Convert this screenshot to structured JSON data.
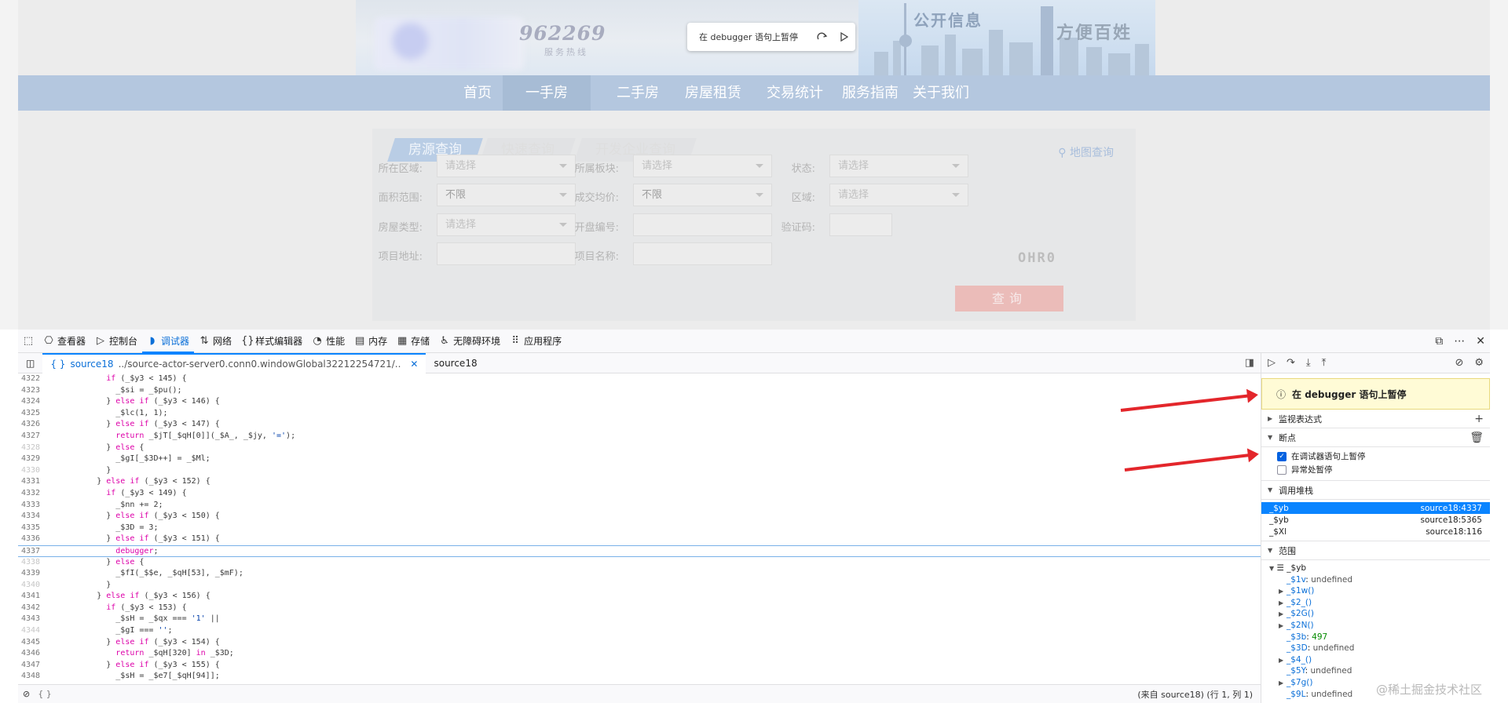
{
  "website": {
    "hotline": "962269",
    "hotline_sub": "服务热线",
    "slogan_left": "公开信息",
    "slogan_right": "方便百姓",
    "nav": [
      "首页",
      "一手房",
      "二手房",
      "房屋租赁",
      "交易统计",
      "服务指南",
      "关于我们"
    ],
    "nav_active": 1,
    "tabs": [
      "房源查询",
      "快速查询",
      "开发企业查询"
    ],
    "map_query": "地图查询",
    "fields": [
      {
        "label": "所在区域:",
        "value": "请选择",
        "type": "select"
      },
      {
        "label": "所属板块:",
        "value": "请选择",
        "type": "select"
      },
      {
        "label": "状态:",
        "value": "请选择",
        "type": "select"
      },
      {
        "label": "面积范围:",
        "value": "不限",
        "type": "select"
      },
      {
        "label": "成交均价:",
        "value": "不限",
        "type": "select"
      },
      {
        "label": "区域:",
        "value": "请选择",
        "type": "select"
      },
      {
        "label": "房屋类型:",
        "value": "请选择",
        "type": "select"
      },
      {
        "label": "开盘编号:",
        "value": "",
        "type": "text"
      },
      {
        "label": "验证码:",
        "value": "",
        "type": "text"
      },
      {
        "label": "项目地址:",
        "value": "",
        "type": "text"
      },
      {
        "label": "项目名称:",
        "value": "",
        "type": "text"
      }
    ],
    "captcha": "OHR0",
    "query_button": "查询"
  },
  "pause_overlay": {
    "label": "在 debugger 语句上暂停"
  },
  "devtools": {
    "tools": [
      {
        "icon": "⎔",
        "label": "查看器"
      },
      {
        "icon": "▷",
        "label": "控制台"
      },
      {
        "icon": "◗",
        "label": "调试器"
      },
      {
        "icon": "⇅",
        "label": "网络"
      },
      {
        "icon": "{}",
        "label": "样式编辑器"
      },
      {
        "icon": "◔",
        "label": "性能"
      },
      {
        "icon": "▤",
        "label": "内存"
      },
      {
        "icon": "▦",
        "label": "存储"
      },
      {
        "icon": "♿",
        "label": "无障碍环境"
      },
      {
        "icon": "⠿",
        "label": "应用程序"
      }
    ],
    "active_tool": 2,
    "source_tabs": [
      {
        "label": "source18",
        "path": "../source-actor-server0.conn0.windowGlobal32212254721/..",
        "active": true
      },
      {
        "label": "source18",
        "path": "",
        "active": false
      }
    ],
    "code_lines": [
      {
        "n": "4322",
        "t": "            if (_$y3 < 145) {",
        "f": false
      },
      {
        "n": "4323",
        "t": "              _$si = _$pu();",
        "f": false
      },
      {
        "n": "4324",
        "t": "            } else if (_$y3 < 146) {",
        "f": false
      },
      {
        "n": "4325",
        "t": "              _$lc(1, 1);",
        "f": false
      },
      {
        "n": "4326",
        "t": "            } else if (_$y3 < 147) {",
        "f": false
      },
      {
        "n": "4327",
        "t": "              return _$jT[_$qH[0]](_$A_, _$jy, '=');",
        "f": false
      },
      {
        "n": "4328",
        "t": "            } else {",
        "f": true
      },
      {
        "n": "4329",
        "t": "              _$gI[_$3D++] = _$Ml;",
        "f": false
      },
      {
        "n": "4330",
        "t": "            }",
        "f": true
      },
      {
        "n": "4331",
        "t": "          } else if (_$y3 < 152) {",
        "f": false
      },
      {
        "n": "4332",
        "t": "            if (_$y3 < 149) {",
        "f": false
      },
      {
        "n": "4333",
        "t": "              _$nn += 2;",
        "f": false
      },
      {
        "n": "4334",
        "t": "            } else if (_$y3 < 150) {",
        "f": false
      },
      {
        "n": "4335",
        "t": "              _$3D = 3;",
        "f": false
      },
      {
        "n": "4336",
        "t": "            } else if (_$y3 < 151) {",
        "f": false
      },
      {
        "n": "4337",
        "t": "              debugger;",
        "f": false
      },
      {
        "n": "4338",
        "t": "            } else {",
        "f": true
      },
      {
        "n": "4339",
        "t": "              _$fI(_$$e, _$qH[53], _$mF);",
        "f": false
      },
      {
        "n": "4340",
        "t": "            }",
        "f": true
      },
      {
        "n": "4341",
        "t": "          } else if (_$y3 < 156) {",
        "f": false
      },
      {
        "n": "4342",
        "t": "            if (_$y3 < 153) {",
        "f": false
      },
      {
        "n": "4343",
        "t": "              _$sH = _$qx === '1' ||",
        "f": false
      },
      {
        "n": "4344",
        "t": "              _$gI === '';",
        "f": true
      },
      {
        "n": "4345",
        "t": "            } else if (_$y3 < 154) {",
        "f": false
      },
      {
        "n": "4346",
        "t": "              return _$qH[320] in _$3D;",
        "f": false
      },
      {
        "n": "4347",
        "t": "            } else if (_$y3 < 155) {",
        "f": false
      },
      {
        "n": "4348",
        "t": "              _$sH = _$e7[_$qH[94]];",
        "f": false
      }
    ],
    "paused_line": "4337",
    "status_left": "{ }",
    "status_pos": "(来自 source18)  (行 1, 列 1)",
    "paused_message": "在 debugger 语句上暂停",
    "watch_label": "监视表达式",
    "breakpoints_label": "断点",
    "bp_options": [
      {
        "label": "在调试器语句上暂停",
        "checked": true
      },
      {
        "label": "异常处暂停",
        "checked": false
      }
    ],
    "callstack_label": "调用堆栈",
    "frames": [
      {
        "name": "_$yb",
        "loc": "source18:4337"
      },
      {
        "name": "_$yb",
        "loc": "source18:5365"
      },
      {
        "name": "_$Xl",
        "loc": "source18:116"
      }
    ],
    "scopes_label": "范围",
    "scope_root": "_$yb",
    "scope_items": [
      {
        "expand": false,
        "name": "_$1v",
        "val": "undefined",
        "kind": "undef"
      },
      {
        "expand": true,
        "name": "_$1w()",
        "val": "",
        "kind": ""
      },
      {
        "expand": true,
        "name": "_$2_()",
        "val": "",
        "kind": ""
      },
      {
        "expand": true,
        "name": "_$2G()",
        "val": "",
        "kind": ""
      },
      {
        "expand": true,
        "name": "_$2N()",
        "val": "",
        "kind": ""
      },
      {
        "expand": false,
        "name": "_$3b",
        "val": "497",
        "kind": "num"
      },
      {
        "expand": false,
        "name": "_$3D",
        "val": "undefined",
        "kind": "undef"
      },
      {
        "expand": true,
        "name": "_$4_()",
        "val": "",
        "kind": ""
      },
      {
        "expand": false,
        "name": "_$5Y",
        "val": "undefined",
        "kind": "undef"
      },
      {
        "expand": true,
        "name": "_$7g()",
        "val": "",
        "kind": ""
      },
      {
        "expand": false,
        "name": "_$9L",
        "val": "undefined",
        "kind": "undef"
      }
    ]
  },
  "watermark": "@稀土掘金技术社区"
}
